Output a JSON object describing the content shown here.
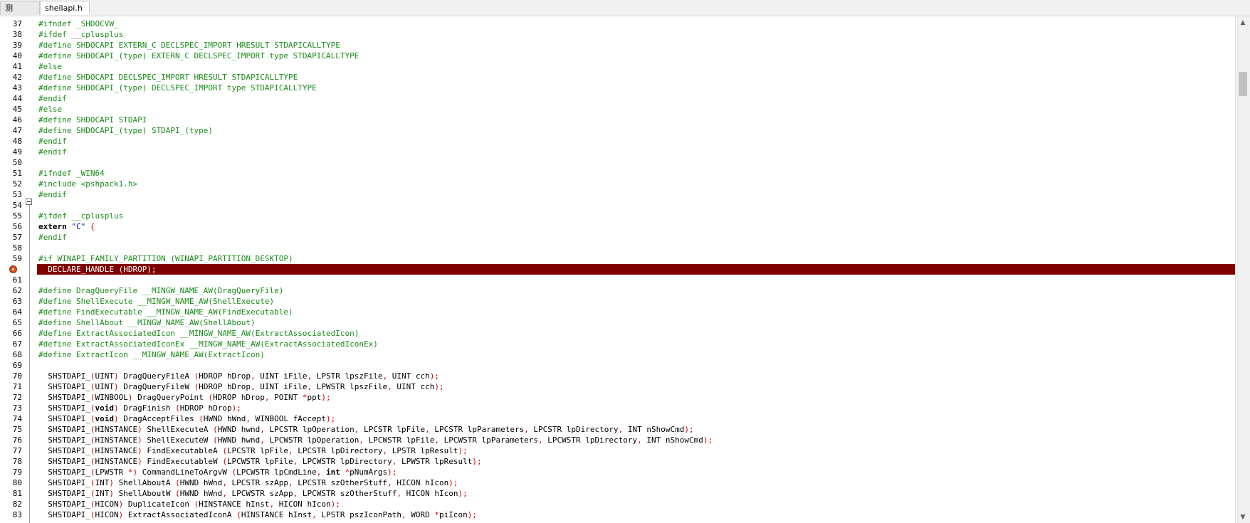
{
  "tabs": [
    {
      "label": "测试.cpp",
      "active": false
    },
    {
      "label": "shellapi.h",
      "active": true
    }
  ],
  "editor": {
    "lines": [
      {
        "n": "37",
        "t": [
          [
            "pp",
            "#ifndef _SHDOCVW_"
          ]
        ]
      },
      {
        "n": "38",
        "t": [
          [
            "pp",
            "#ifdef __cplusplus"
          ]
        ]
      },
      {
        "n": "39",
        "t": [
          [
            "pp",
            "#define SHDOCAPI EXTERN_C DECLSPEC_IMPORT HRESULT STDAPICALLTYPE"
          ]
        ]
      },
      {
        "n": "40",
        "t": [
          [
            "pp",
            "#define SHDOCAPI_(type) EXTERN_C DECLSPEC_IMPORT type STDAPICALLTYPE"
          ]
        ]
      },
      {
        "n": "41",
        "t": [
          [
            "pp",
            "#else"
          ]
        ]
      },
      {
        "n": "42",
        "t": [
          [
            "pp",
            "#define SHDOCAPI DECLSPEC_IMPORT HRESULT STDAPICALLTYPE"
          ]
        ]
      },
      {
        "n": "43",
        "t": [
          [
            "pp",
            "#define SHDOCAPI_(type) DECLSPEC_IMPORT type STDAPICALLTYPE"
          ]
        ]
      },
      {
        "n": "44",
        "t": [
          [
            "pp",
            "#endif"
          ]
        ]
      },
      {
        "n": "45",
        "t": [
          [
            "pp",
            "#else"
          ]
        ]
      },
      {
        "n": "46",
        "t": [
          [
            "pp",
            "#define SHDOCAPI STDAPI"
          ]
        ]
      },
      {
        "n": "47",
        "t": [
          [
            "pp",
            "#define SHDOCAPI_(type) STDAPI_(type)"
          ]
        ]
      },
      {
        "n": "48",
        "t": [
          [
            "pp",
            "#endif"
          ]
        ]
      },
      {
        "n": "49",
        "t": [
          [
            "pp",
            "#endif"
          ]
        ]
      },
      {
        "n": "50",
        "t": []
      },
      {
        "n": "51",
        "t": [
          [
            "pp",
            "#ifndef _WIN64"
          ]
        ]
      },
      {
        "n": "52",
        "t": [
          [
            "pp",
            "#include <pshpack1.h>"
          ]
        ]
      },
      {
        "n": "53",
        "t": [
          [
            "pp",
            "#endif"
          ]
        ]
      },
      {
        "n": "54",
        "t": []
      },
      {
        "n": "55",
        "t": [
          [
            "pp",
            "#ifdef __cplusplus"
          ]
        ]
      },
      {
        "n": "56",
        "t": [
          [
            "kw",
            "extern "
          ],
          [
            "str",
            "\"C\""
          ],
          [
            "plain",
            " "
          ],
          [
            "sym",
            "{"
          ]
        ],
        "fold": true
      },
      {
        "n": "57",
        "t": [
          [
            "pp",
            "#endif"
          ]
        ]
      },
      {
        "n": "58",
        "t": []
      },
      {
        "n": "59",
        "t": [
          [
            "pp",
            "#if WINAPI_FAMILY_PARTITION (WINAPI_PARTITION_DESKTOP)"
          ]
        ]
      },
      {
        "n": "60",
        "t": [
          [
            "plain",
            "  DECLARE_HANDLE (HDROP);"
          ]
        ],
        "highlight": true
      },
      {
        "n": "61",
        "t": []
      },
      {
        "n": "62",
        "t": [
          [
            "pp",
            "#define DragQueryFile __MINGW_NAME_AW(DragQueryFile)"
          ]
        ]
      },
      {
        "n": "63",
        "t": [
          [
            "pp",
            "#define ShellExecute __MINGW_NAME_AW(ShellExecute)"
          ]
        ]
      },
      {
        "n": "64",
        "t": [
          [
            "pp",
            "#define FindExecutable __MINGW_NAME_AW(FindExecutable)"
          ]
        ]
      },
      {
        "n": "65",
        "t": [
          [
            "pp",
            "#define ShellAbout __MINGW_NAME_AW(ShellAbout)"
          ]
        ]
      },
      {
        "n": "66",
        "t": [
          [
            "pp",
            "#define ExtractAssociatedIcon __MINGW_NAME_AW(ExtractAssociatedIcon)"
          ]
        ]
      },
      {
        "n": "67",
        "t": [
          [
            "pp",
            "#define ExtractAssociatedIconEx __MINGW_NAME_AW(ExtractAssociatedIconEx)"
          ]
        ]
      },
      {
        "n": "68",
        "t": [
          [
            "pp",
            "#define ExtractIcon __MINGW_NAME_AW(ExtractIcon)"
          ]
        ]
      },
      {
        "n": "69",
        "t": []
      },
      {
        "n": "70",
        "t": [
          [
            "plain",
            "  SHSTDAPI_"
          ],
          [
            "sym",
            "("
          ],
          [
            "plain",
            "UINT"
          ],
          [
            "sym",
            ")"
          ],
          [
            "plain",
            " DragQueryFileA "
          ],
          [
            "sym",
            "("
          ],
          [
            "plain",
            "HDROP hDrop"
          ],
          [
            "sym",
            ","
          ],
          [
            "plain",
            " UINT iFile"
          ],
          [
            "sym",
            ","
          ],
          [
            "plain",
            " LPSTR lpszFile"
          ],
          [
            "sym",
            ","
          ],
          [
            "plain",
            " UINT cch"
          ],
          [
            "sym",
            ");"
          ]
        ]
      },
      {
        "n": "71",
        "t": [
          [
            "plain",
            "  SHSTDAPI_"
          ],
          [
            "sym",
            "("
          ],
          [
            "plain",
            "UINT"
          ],
          [
            "sym",
            ")"
          ],
          [
            "plain",
            " DragQueryFileW "
          ],
          [
            "sym",
            "("
          ],
          [
            "plain",
            "HDROP hDrop"
          ],
          [
            "sym",
            ","
          ],
          [
            "plain",
            " UINT iFile"
          ],
          [
            "sym",
            ","
          ],
          [
            "plain",
            " LPWSTR lpszFile"
          ],
          [
            "sym",
            ","
          ],
          [
            "plain",
            " UINT cch"
          ],
          [
            "sym",
            ");"
          ]
        ]
      },
      {
        "n": "72",
        "t": [
          [
            "plain",
            "  SHSTDAPI_"
          ],
          [
            "sym",
            "("
          ],
          [
            "plain",
            "WINBOOL"
          ],
          [
            "sym",
            ")"
          ],
          [
            "plain",
            " DragQueryPoint "
          ],
          [
            "sym",
            "("
          ],
          [
            "plain",
            "HDROP hDrop"
          ],
          [
            "sym",
            ","
          ],
          [
            "plain",
            " POINT "
          ],
          [
            "sym",
            "*"
          ],
          [
            "plain",
            "ppt"
          ],
          [
            "sym",
            ");"
          ]
        ]
      },
      {
        "n": "73",
        "t": [
          [
            "plain",
            "  SHSTDAPI_"
          ],
          [
            "sym",
            "("
          ],
          [
            "kw",
            "void"
          ],
          [
            "sym",
            ")"
          ],
          [
            "plain",
            " DragFinish "
          ],
          [
            "sym",
            "("
          ],
          [
            "plain",
            "HDROP hDrop"
          ],
          [
            "sym",
            ");"
          ]
        ]
      },
      {
        "n": "74",
        "t": [
          [
            "plain",
            "  SHSTDAPI_"
          ],
          [
            "sym",
            "("
          ],
          [
            "kw",
            "void"
          ],
          [
            "sym",
            ")"
          ],
          [
            "plain",
            " DragAcceptFiles "
          ],
          [
            "sym",
            "("
          ],
          [
            "plain",
            "HWND hWnd"
          ],
          [
            "sym",
            ","
          ],
          [
            "plain",
            " WINBOOL fAccept"
          ],
          [
            "sym",
            ");"
          ]
        ]
      },
      {
        "n": "75",
        "t": [
          [
            "plain",
            "  SHSTDAPI_"
          ],
          [
            "sym",
            "("
          ],
          [
            "plain",
            "HINSTANCE"
          ],
          [
            "sym",
            ")"
          ],
          [
            "plain",
            " ShellExecuteA "
          ],
          [
            "sym",
            "("
          ],
          [
            "plain",
            "HWND hwnd"
          ],
          [
            "sym",
            ","
          ],
          [
            "plain",
            " LPCSTR lpOperation"
          ],
          [
            "sym",
            ","
          ],
          [
            "plain",
            " LPCSTR lpFile"
          ],
          [
            "sym",
            ","
          ],
          [
            "plain",
            " LPCSTR lpParameters"
          ],
          [
            "sym",
            ","
          ],
          [
            "plain",
            " LPCSTR lpDirectory"
          ],
          [
            "sym",
            ","
          ],
          [
            "plain",
            " INT nShowCmd"
          ],
          [
            "sym",
            ");"
          ]
        ]
      },
      {
        "n": "76",
        "t": [
          [
            "plain",
            "  SHSTDAPI_"
          ],
          [
            "sym",
            "("
          ],
          [
            "plain",
            "HINSTANCE"
          ],
          [
            "sym",
            ")"
          ],
          [
            "plain",
            " ShellExecuteW "
          ],
          [
            "sym",
            "("
          ],
          [
            "plain",
            "HWND hwnd"
          ],
          [
            "sym",
            ","
          ],
          [
            "plain",
            " LPCWSTR lpOperation"
          ],
          [
            "sym",
            ","
          ],
          [
            "plain",
            " LPCWSTR lpFile"
          ],
          [
            "sym",
            ","
          ],
          [
            "plain",
            " LPCWSTR lpParameters"
          ],
          [
            "sym",
            ","
          ],
          [
            "plain",
            " LPCWSTR lpDirectory"
          ],
          [
            "sym",
            ","
          ],
          [
            "plain",
            " INT nShowCmd"
          ],
          [
            "sym",
            ");"
          ]
        ]
      },
      {
        "n": "77",
        "t": [
          [
            "plain",
            "  SHSTDAPI_"
          ],
          [
            "sym",
            "("
          ],
          [
            "plain",
            "HINSTANCE"
          ],
          [
            "sym",
            ")"
          ],
          [
            "plain",
            " FindExecutableA "
          ],
          [
            "sym",
            "("
          ],
          [
            "plain",
            "LPCSTR lpFile"
          ],
          [
            "sym",
            ","
          ],
          [
            "plain",
            " LPCSTR lpDirectory"
          ],
          [
            "sym",
            ","
          ],
          [
            "plain",
            " LPSTR lpResult"
          ],
          [
            "sym",
            ");"
          ]
        ]
      },
      {
        "n": "78",
        "t": [
          [
            "plain",
            "  SHSTDAPI_"
          ],
          [
            "sym",
            "("
          ],
          [
            "plain",
            "HINSTANCE"
          ],
          [
            "sym",
            ")"
          ],
          [
            "plain",
            " FindExecutableW "
          ],
          [
            "sym",
            "("
          ],
          [
            "plain",
            "LPCWSTR lpFile"
          ],
          [
            "sym",
            ","
          ],
          [
            "plain",
            " LPCWSTR lpDirectory"
          ],
          [
            "sym",
            ","
          ],
          [
            "plain",
            " LPWSTR lpResult"
          ],
          [
            "sym",
            ");"
          ]
        ]
      },
      {
        "n": "79",
        "t": [
          [
            "plain",
            "  SHSTDAPI_"
          ],
          [
            "sym",
            "("
          ],
          [
            "plain",
            "LPWSTR "
          ],
          [
            "sym",
            "*)"
          ],
          [
            "plain",
            " CommandLineToArgvW "
          ],
          [
            "sym",
            "("
          ],
          [
            "plain",
            "LPCWSTR lpCmdLine"
          ],
          [
            "sym",
            ","
          ],
          [
            "plain",
            " "
          ],
          [
            "kw",
            "int"
          ],
          [
            "plain",
            " "
          ],
          [
            "sym",
            "*"
          ],
          [
            "plain",
            "pNumArgs"
          ],
          [
            "sym",
            ");"
          ]
        ]
      },
      {
        "n": "80",
        "t": [
          [
            "plain",
            "  SHSTDAPI_"
          ],
          [
            "sym",
            "("
          ],
          [
            "plain",
            "INT"
          ],
          [
            "sym",
            ")"
          ],
          [
            "plain",
            " ShellAboutA "
          ],
          [
            "sym",
            "("
          ],
          [
            "plain",
            "HWND hWnd"
          ],
          [
            "sym",
            ","
          ],
          [
            "plain",
            " LPCSTR szApp"
          ],
          [
            "sym",
            ","
          ],
          [
            "plain",
            " LPCSTR szOtherStuff"
          ],
          [
            "sym",
            ","
          ],
          [
            "plain",
            " HICON hIcon"
          ],
          [
            "sym",
            ");"
          ]
        ]
      },
      {
        "n": "81",
        "t": [
          [
            "plain",
            "  SHSTDAPI_"
          ],
          [
            "sym",
            "("
          ],
          [
            "plain",
            "INT"
          ],
          [
            "sym",
            ")"
          ],
          [
            "plain",
            " ShellAboutW "
          ],
          [
            "sym",
            "("
          ],
          [
            "plain",
            "HWND hWnd"
          ],
          [
            "sym",
            ","
          ],
          [
            "plain",
            " LPCWSTR szApp"
          ],
          [
            "sym",
            ","
          ],
          [
            "plain",
            " LPCWSTR szOtherStuff"
          ],
          [
            "sym",
            ","
          ],
          [
            "plain",
            " HICON hIcon"
          ],
          [
            "sym",
            ");"
          ]
        ]
      },
      {
        "n": "82",
        "t": [
          [
            "plain",
            "  SHSTDAPI_"
          ],
          [
            "sym",
            "("
          ],
          [
            "plain",
            "HICON"
          ],
          [
            "sym",
            ")"
          ],
          [
            "plain",
            " DuplicateIcon "
          ],
          [
            "sym",
            "("
          ],
          [
            "plain",
            "HINSTANCE hInst"
          ],
          [
            "sym",
            ","
          ],
          [
            "plain",
            " HICON hIcon"
          ],
          [
            "sym",
            ");"
          ]
        ]
      },
      {
        "n": "83",
        "t": [
          [
            "plain",
            "  SHSTDAPI_"
          ],
          [
            "sym",
            "("
          ],
          [
            "plain",
            "HICON"
          ],
          [
            "sym",
            ")"
          ],
          [
            "plain",
            " ExtractAssociatedIconA "
          ],
          [
            "sym",
            "("
          ],
          [
            "plain",
            "HINSTANCE hInst"
          ],
          [
            "sym",
            ","
          ],
          [
            "plain",
            " LPSTR pszIconPath"
          ],
          [
            "sym",
            ","
          ],
          [
            "plain",
            " WORD "
          ],
          [
            "sym",
            "*"
          ],
          [
            "plain",
            "piIcon"
          ],
          [
            "sym",
            ");"
          ]
        ]
      }
    ]
  },
  "scrollbar": {
    "position_fraction": 0.09,
    "visible_fraction": 0.05
  },
  "colors": {
    "preprocessor": "#1a8c1a",
    "highlight_bg": "#800000",
    "string": "#0000d0",
    "symbol": "#d10000"
  }
}
